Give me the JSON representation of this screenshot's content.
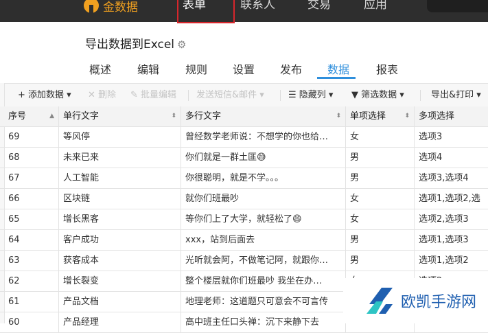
{
  "topbar": {
    "brand": "金数据",
    "nav": [
      "表单",
      "联系人",
      "交易",
      "应用"
    ]
  },
  "page": {
    "title": "导出数据到Excel",
    "tabs": [
      "概述",
      "编辑",
      "规则",
      "设置",
      "发布",
      "数据",
      "报表"
    ],
    "active_tab": "数据"
  },
  "toolbar": {
    "add": "+ 添加数据 ▾",
    "delete": "✕ 删除",
    "batch_edit": "✎ 批量编辑",
    "send": "发送短信&邮件 ▾",
    "hide_cols": "☰ 隐藏列 ▾",
    "filter": "▼ 筛选数据 ▾",
    "export": "导出&打印 ▾"
  },
  "table": {
    "headers": [
      "序号",
      "单行文字",
      "多行文字",
      "单项选择",
      "多项选择"
    ],
    "rows": [
      [
        "69",
        "等风停",
        "曾经数学老师说：不想学的你也给…",
        "女",
        "选项3"
      ],
      [
        "68",
        "未来已来",
        "你们就是一群土匪😅",
        "男",
        "选项4"
      ],
      [
        "67",
        "人工智能",
        "你很聪明，就是不学。。。",
        "男",
        "选项3,选项4"
      ],
      [
        "66",
        "区块链",
        "就你们班最吵",
        "女",
        "选项1,选项2,选"
      ],
      [
        "65",
        "增长黑客",
        "等你们上了大学，就轻松了😄",
        "女",
        "选项2,选项3"
      ],
      [
        "64",
        "客户成功",
        "xxx，站到后面去",
        "男",
        "选项1,选项3"
      ],
      [
        "63",
        "获客成本",
        "光听就会阿，不做笔记阿，就跟你…",
        "男",
        "选项1,选项2"
      ],
      [
        "62",
        "增长裂变",
        "整个楼层就你们班最吵 我坐在办…",
        "女",
        "选项2"
      ],
      [
        "61",
        "产品文档",
        "地理老师：这道题只可意会不可言传",
        "女",
        ""
      ],
      [
        "60",
        "产品经理",
        "高中班主任口头禅：沉下来静下去",
        "",
        ""
      ]
    ]
  },
  "watermark": {
    "text": "欧凯手游网"
  },
  "colors": {
    "topbar": "#2e2e2e",
    "accent": "#2f8fdc",
    "highlight_box": "#d8262c",
    "brand": "#f0a020"
  }
}
